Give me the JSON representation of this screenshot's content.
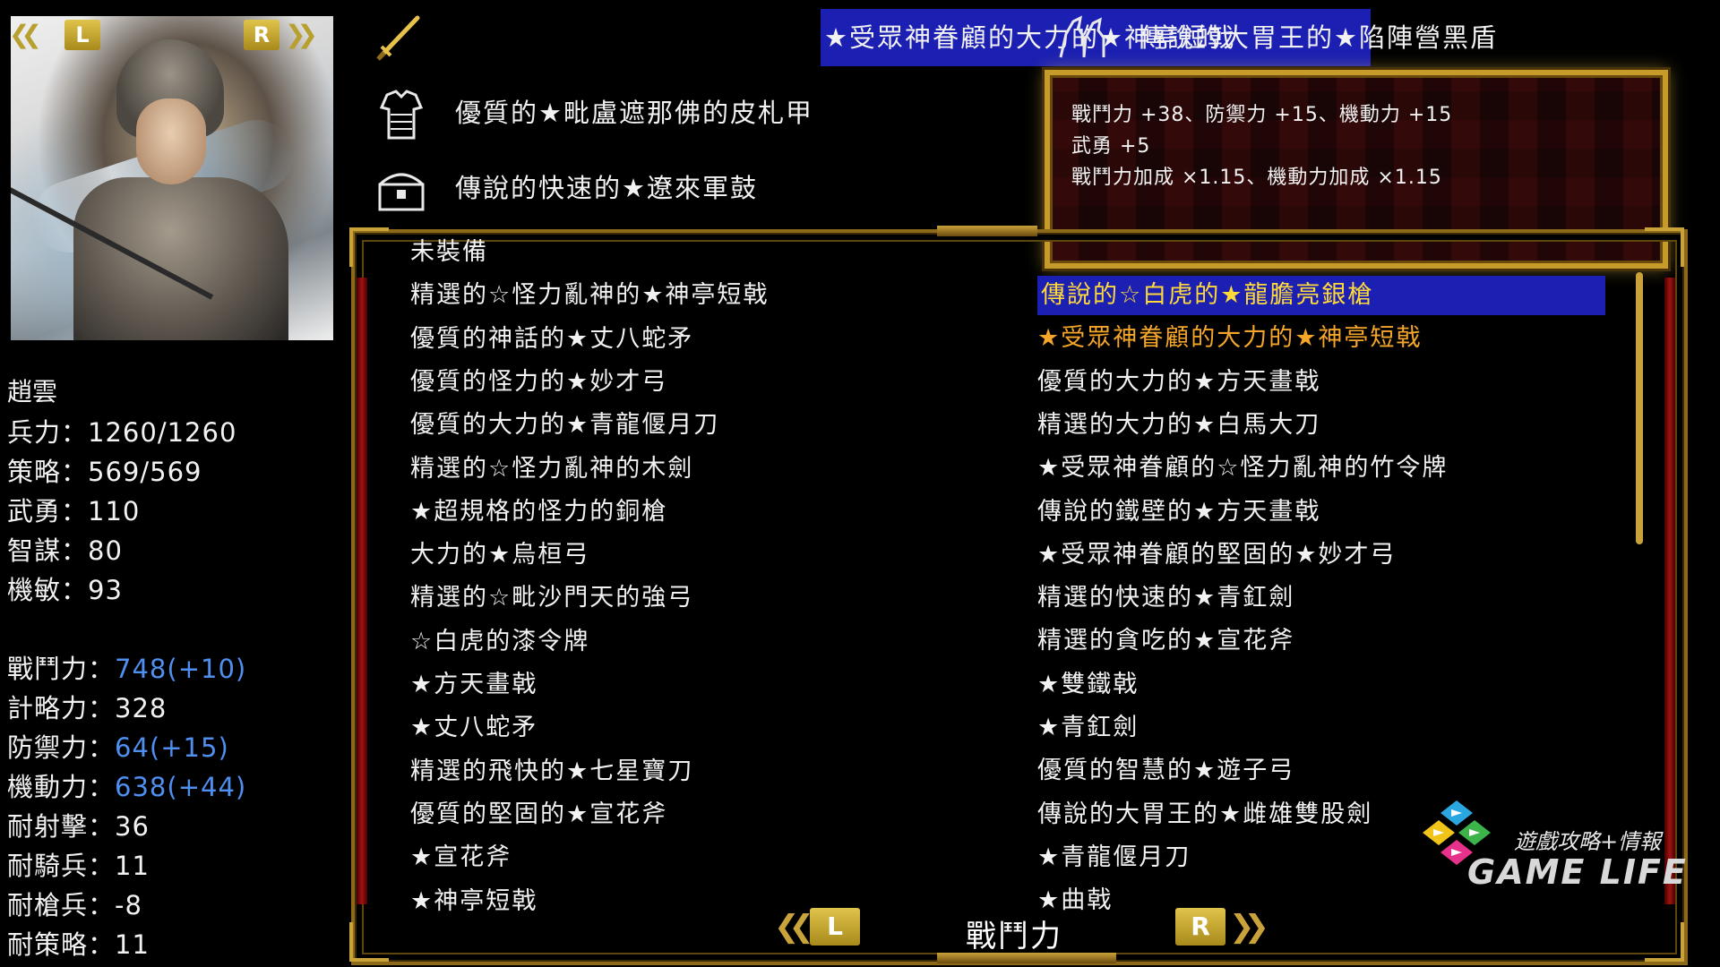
{
  "shoulder": {
    "left_key": "L",
    "right_key": "R"
  },
  "character": {
    "name": "趙雲",
    "stats": [
      {
        "label": "兵力",
        "value": "1260/1260",
        "highlight": false
      },
      {
        "label": "策略",
        "value": "569/569",
        "highlight": false
      },
      {
        "label": "武勇",
        "value": "110",
        "highlight": false
      },
      {
        "label": "智謀",
        "value": "80",
        "highlight": false
      },
      {
        "label": "機敏",
        "value": "93",
        "highlight": false
      }
    ],
    "combat": [
      {
        "label": "戰鬥力",
        "value": "748(+10)",
        "highlight": true
      },
      {
        "label": "計略力",
        "value": "328",
        "highlight": false
      },
      {
        "label": "防禦力",
        "value": "64(+15)",
        "highlight": true
      },
      {
        "label": "機動力",
        "value": "638(+44)",
        "highlight": true
      },
      {
        "label": "耐射擊",
        "value": "36",
        "highlight": false
      },
      {
        "label": "耐騎兵",
        "value": "11",
        "highlight": false
      },
      {
        "label": "耐槍兵",
        "value": "-8",
        "highlight": false
      },
      {
        "label": "耐策略",
        "value": "11",
        "highlight": false
      }
    ]
  },
  "equipped": {
    "weapon": {
      "icon": "sword-icon",
      "name": "★受眾神眷顧的大力的★神亭短戟"
    },
    "armor": {
      "icon": "armor-icon",
      "name": "優質的★毗盧遮那佛的皮札甲"
    },
    "accessory": {
      "icon": "chest-icon",
      "name": "傳說的快速的★遼來軍鼓"
    },
    "horse": {
      "icon": "horse-icon",
      "name": "傳說的大胃王的★陷陣營黑盾"
    }
  },
  "tooltip": {
    "lines": [
      "戰鬥力 +38、防禦力 +15、機動力 +15",
      "武勇 +5",
      "戰鬥力加成 ×1.15、機動力加成 ×1.15"
    ]
  },
  "list": {
    "left": [
      "未裝備",
      "精選的☆怪力亂神的★神亭短戟",
      "優質的神話的★丈八蛇矛",
      "優質的怪力的★妙才弓",
      "優質的大力的★青龍偃月刀",
      "精選的☆怪力亂神的木劍",
      "★超規格的怪力的銅槍",
      "大力的★烏桓弓",
      "精選的☆毗沙門天的強弓",
      "☆白虎的漆令牌",
      "★方天畫戟",
      "★丈八蛇矛",
      "精選的飛快的★七星寶刀",
      "優質的堅固的★宣花斧",
      "★宣花斧",
      "★神亭短戟"
    ],
    "right": [
      "傳說的☆白虎的★龍膽亮銀槍",
      "★受眾神眷顧的大力的★神亭短戟",
      "優質的大力的★方天畫戟",
      "精選的大力的★白馬大刀",
      "★受眾神眷顧的☆怪力亂神的竹令牌",
      "傳說的鐵壁的★方天畫戟",
      "★受眾神眷顧的堅固的★妙才弓",
      "精選的快速的★青釭劍",
      "精選的貪吃的★宣花斧",
      "★雙鐵戟",
      "★青釭劍",
      "優質的智慧的★遊子弓",
      "傳說的大胃王的★雌雄雙股劍",
      "★青龍偃月刀",
      "★曲戟"
    ],
    "selected_index": 0,
    "equipped_index": 1
  },
  "footer": {
    "sort_label": "戰鬥力",
    "prev_key": "L",
    "next_key": "R"
  },
  "watermark": {
    "tagline": "遊戲攻略+情報",
    "brand": "GAME LIFE"
  },
  "colors": {
    "selection_bg": "#1b1fb2",
    "selection_text": "#ffd93a",
    "equipped_text": "#f5a62a",
    "bonus_value": "#4f8ff0",
    "frame_gold": "#c9a23a",
    "frame_red": "#a01414"
  }
}
